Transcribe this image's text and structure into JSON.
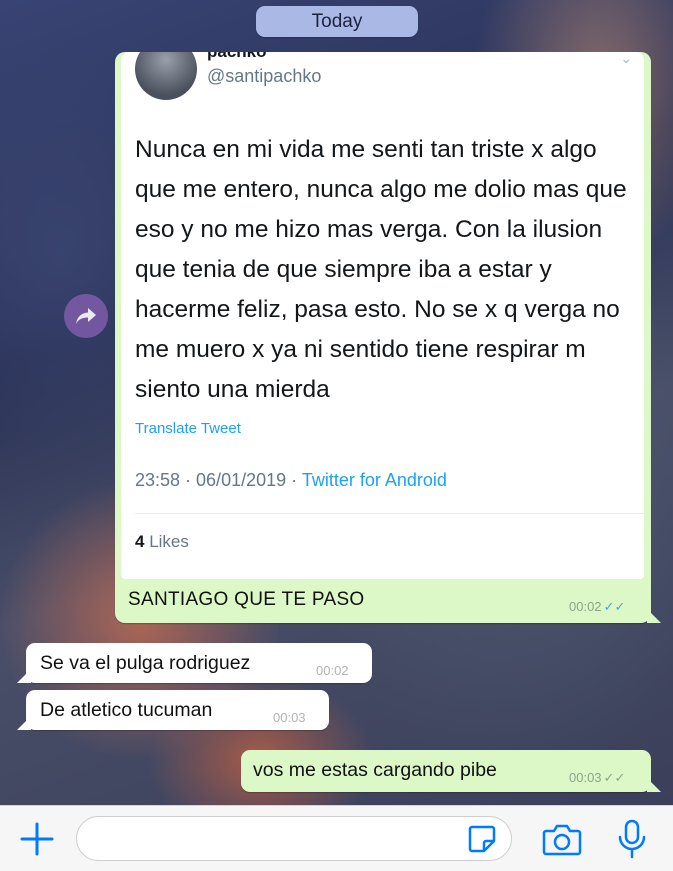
{
  "header": {
    "date_label": "Today"
  },
  "tweet": {
    "display_name": "pachko",
    "handle": "@santipachko",
    "text": "Nunca en mi vida me senti tan triste x algo que me entero, nunca algo me dolio mas que eso y no me hizo mas verga. Con la ilusion que tenia de que siempre iba a estar y hacerme feliz, pasa esto. No se x q verga no me muero x ya ni sentido tiene respirar m siento una mierda",
    "translate_label": "Translate Tweet",
    "timestamp": "23:58 · 06/01/2019 · ",
    "source": "Twitter for Android",
    "likes_count": "4",
    "likes_label": " Likes"
  },
  "messages": [
    {
      "direction": "out",
      "text": "SANTIAGO QUE TE PASO",
      "time": "00:02",
      "status": "read"
    },
    {
      "direction": "in",
      "text": "Se va el pulga rodriguez",
      "time": "00:02"
    },
    {
      "direction": "in",
      "text": "De atletico tucuman",
      "time": "00:03"
    },
    {
      "direction": "out",
      "text": "vos me estas cargando pibe",
      "time": "00:03",
      "status": "delivered"
    }
  ],
  "ticks_glyph": "✓✓",
  "composer": {
    "placeholder": "",
    "value": ""
  },
  "icons": {
    "forward": "forward-arrow-icon",
    "plus": "plus-icon",
    "sticker": "sticker-icon",
    "camera": "camera-icon",
    "mic": "microphone-icon"
  },
  "colors": {
    "outgoing_bubble": "#dcf8c6",
    "incoming_bubble": "#ffffff",
    "accent_blue": "#007aff",
    "twitter_blue": "#1da1f2",
    "read_ticks": "#4fa3e0",
    "date_pill": "#aab8e6"
  }
}
